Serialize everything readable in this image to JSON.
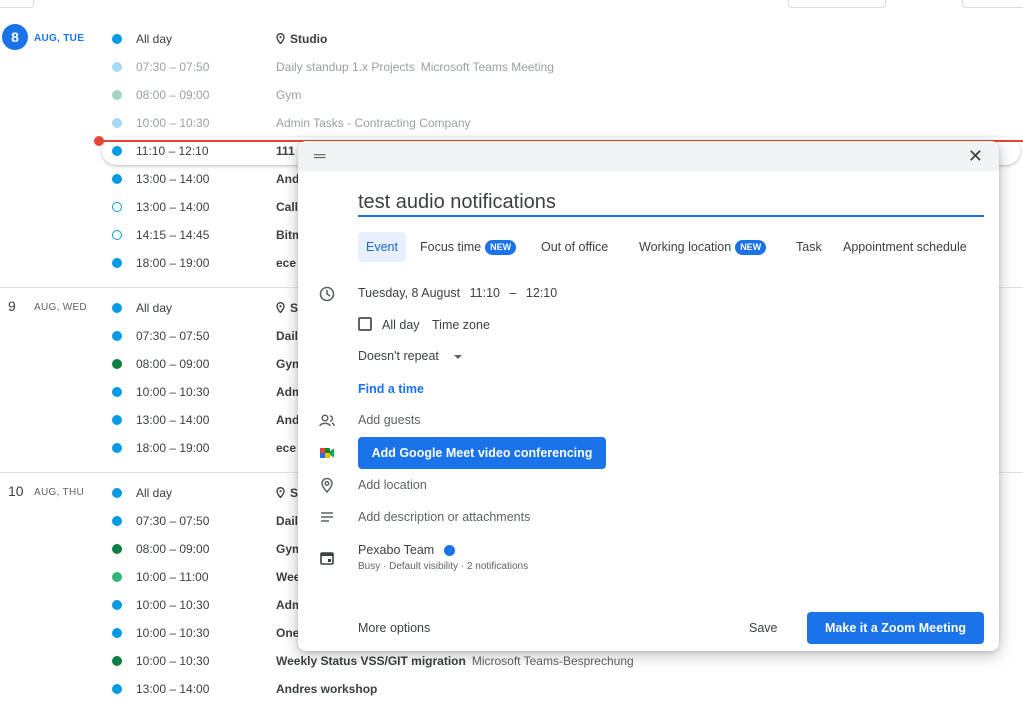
{
  "colors": {
    "accent": "#1a73e8",
    "now_line": "#ea4335",
    "dot_blue": "#039be5",
    "dot_green": "#0b8043",
    "dot_sage": "#33b679"
  },
  "days": [
    {
      "num": "8",
      "label": "AUG, TUE",
      "today": true,
      "events": [
        {
          "time": "All day",
          "title": "Studio",
          "location_icon": true,
          "color": "#039be5"
        },
        {
          "time": "07:30 – 07:50",
          "title": "Daily standup 1.x Projects",
          "sub": "Microsoft Teams Meeting",
          "color": "#a8d9f5",
          "past": true
        },
        {
          "time": "08:00 – 09:00",
          "title": "Gym",
          "color": "#a6d4c0",
          "past": true
        },
        {
          "time": "10:00 – 10:30",
          "title": "Admin Tasks - Contracting Company",
          "color": "#a8d9f5",
          "past": true
        },
        {
          "time": "11:10 – 12:10",
          "title": "111",
          "color": "#039be5",
          "highlight": true
        },
        {
          "time": "13:00 – 14:00",
          "title": "And",
          "color": "#039be5"
        },
        {
          "time": "13:00 – 14:00",
          "title": "Call",
          "color": "#039be5",
          "hollow": true
        },
        {
          "time": "14:15 – 14:45",
          "title": "Bitm",
          "color": "#039be5",
          "hollow": true
        },
        {
          "time": "18:00 – 19:00",
          "title": "ece",
          "color": "#039be5"
        }
      ]
    },
    {
      "num": "9",
      "label": "AUG, WED",
      "today": false,
      "events": [
        {
          "time": "All day",
          "title": "S",
          "location_icon": true,
          "color": "#039be5"
        },
        {
          "time": "07:30 – 07:50",
          "title": "Dail",
          "color": "#039be5"
        },
        {
          "time": "08:00 – 09:00",
          "title": "Gym",
          "color": "#0b8043"
        },
        {
          "time": "10:00 – 10:30",
          "title": "Adm",
          "color": "#039be5"
        },
        {
          "time": "13:00 – 14:00",
          "title": "And",
          "color": "#039be5"
        },
        {
          "time": "18:00 – 19:00",
          "title": "ece",
          "color": "#039be5"
        }
      ]
    },
    {
      "num": "10",
      "label": "AUG, THU",
      "today": false,
      "events": [
        {
          "time": "All day",
          "title": "S",
          "location_icon": true,
          "color": "#039be5"
        },
        {
          "time": "07:30 – 07:50",
          "title": "Dail",
          "color": "#039be5"
        },
        {
          "time": "08:00 – 09:00",
          "title": "Gym",
          "color": "#0b8043"
        },
        {
          "time": "10:00 – 11:00",
          "title": "Wee",
          "color": "#33b679"
        },
        {
          "time": "10:00 – 10:30",
          "title": "Adm",
          "color": "#039be5"
        },
        {
          "time": "10:00 – 10:30",
          "title": "One",
          "color": "#039be5"
        },
        {
          "time": "10:00 – 10:30",
          "title": "Weekly Status VSS/GIT migration",
          "sub": "Microsoft Teams-Besprechung",
          "color": "#0b8043"
        },
        {
          "time": "13:00 – 14:00",
          "title": "Andres workshop",
          "color": "#039be5"
        }
      ]
    }
  ],
  "dialog": {
    "title_value": "test audio notifications",
    "tabs": [
      {
        "label": "Event",
        "active": true
      },
      {
        "label": "Focus time",
        "badge": "NEW"
      },
      {
        "label": "Out of office"
      },
      {
        "label": "Working location",
        "badge": "NEW"
      },
      {
        "label": "Task"
      },
      {
        "label": "Appointment schedule"
      }
    ],
    "date": "Tuesday, 8 August",
    "start": "11:10",
    "dash": "–",
    "end": "12:10",
    "all_day_label": "All day",
    "timezone_label": "Time zone",
    "repeat_label": "Doesn't repeat",
    "find_time": "Find a time",
    "add_guests": "Add guests",
    "meet_button": "Add Google Meet video conferencing",
    "add_location": "Add location",
    "add_description": "Add description or attachments",
    "calendar_name": "Pexabo Team",
    "calendar_sub": "Busy · Default visibility · 2 notifications",
    "more_options": "More options",
    "save": "Save",
    "zoom_button": "Make it a Zoom Meeting"
  }
}
